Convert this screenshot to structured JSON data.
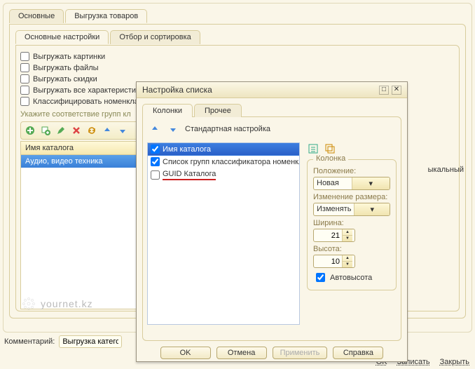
{
  "main": {
    "tabs": [
      "Основные",
      "Выгрузка товаров"
    ],
    "sub_tabs": [
      "Основные настройки",
      "Отбор и сортировка"
    ],
    "checks": [
      "Выгружать картинки",
      "Выгружать файлы",
      "Выгружать скидки",
      "Выгружать все характеристи",
      "Классифицировать номенкла"
    ],
    "hint": "Укажите соответствие групп кл",
    "grid_header": "Имя каталога",
    "grid_row": "Аудио, видео техника",
    "truncated_right": "ыкальный"
  },
  "comment": {
    "label": "Комментарий:",
    "value": "Выгрузка категори"
  },
  "footer": {
    "ok": "OK",
    "save": "Записать",
    "close": "Закрыть"
  },
  "dialog": {
    "title": "Настройка списка",
    "tabs": [
      "Колонки",
      "Прочее"
    ],
    "std": "Стандартная настройка",
    "columns": [
      {
        "label": "Имя каталога",
        "checked": true,
        "selected": true
      },
      {
        "label": "Список групп классификатора номенкл...",
        "checked": true,
        "selected": false
      },
      {
        "label": "GUID Каталога",
        "checked": false,
        "selected": false
      }
    ],
    "group": {
      "legend": "Колонка",
      "pos_label": "Положение:",
      "pos_value": "Новая колонка",
      "resize_label": "Изменение размера:",
      "resize_value": "Изменять",
      "width_label": "Ширина:",
      "width_value": "21",
      "height_label": "Высота:",
      "height_value": "10",
      "autoheight": "Автовысота"
    },
    "btns": {
      "ok": "OK",
      "cancel": "Отмена",
      "apply": "Применить",
      "help": "Справка"
    }
  },
  "watermark": "yournet.kz"
}
